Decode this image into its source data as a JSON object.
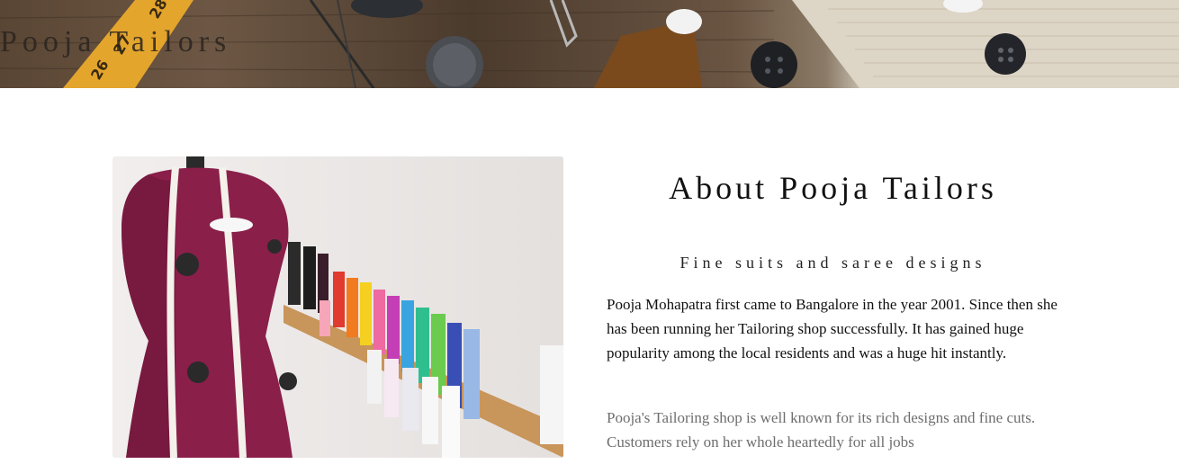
{
  "header": {
    "site_title": "Pooja Tailors",
    "hero_image": "sewing-supplies-banner"
  },
  "about": {
    "image": "dress-form-with-thread-spools",
    "heading": "About Pooja Tailors",
    "subheading": "Fine suits and saree designs",
    "paragraph_1": "Pooja Mohapatra first came to Bangalore in the year 2001. Since then she has been running her Tailoring shop successfully. It has gained huge popularity among the local residents and was a huge hit instantly.",
    "paragraph_2": "Pooja's Tailoring shop is well known for its rich designs and fine cuts. Customers rely on her whole heartedly for all jobs"
  },
  "colors": {
    "heading_text": "#111111",
    "muted_text": "#6e6e6e",
    "dress_form": "#8a1f4a"
  }
}
